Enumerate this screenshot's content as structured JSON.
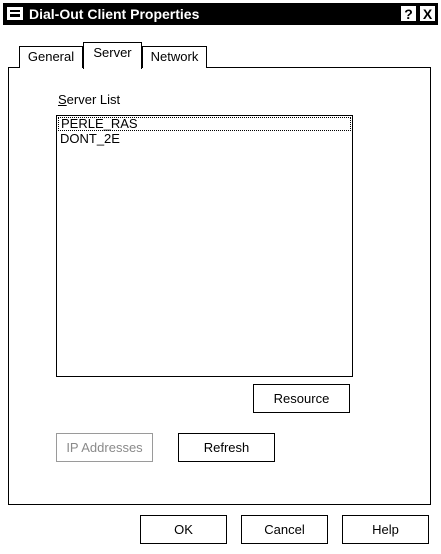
{
  "window": {
    "title": "Dial-Out Client Properties",
    "help_glyph": "?",
    "close_glyph": "X"
  },
  "tabs": [
    {
      "label": "General"
    },
    {
      "label": "Server",
      "selected": true
    },
    {
      "label": "Network"
    }
  ],
  "server_list": {
    "label_accel": "S",
    "label_rest": "erver List",
    "items": [
      "PERLE_RAS",
      "DONT_2E"
    ],
    "focused_index": 0
  },
  "buttons": {
    "resource": "Resource",
    "ip_addresses": "IP Addresses",
    "refresh": "Refresh",
    "ok": "OK",
    "cancel": "Cancel",
    "help": "Help"
  },
  "states": {
    "ip_addresses_disabled": true
  }
}
